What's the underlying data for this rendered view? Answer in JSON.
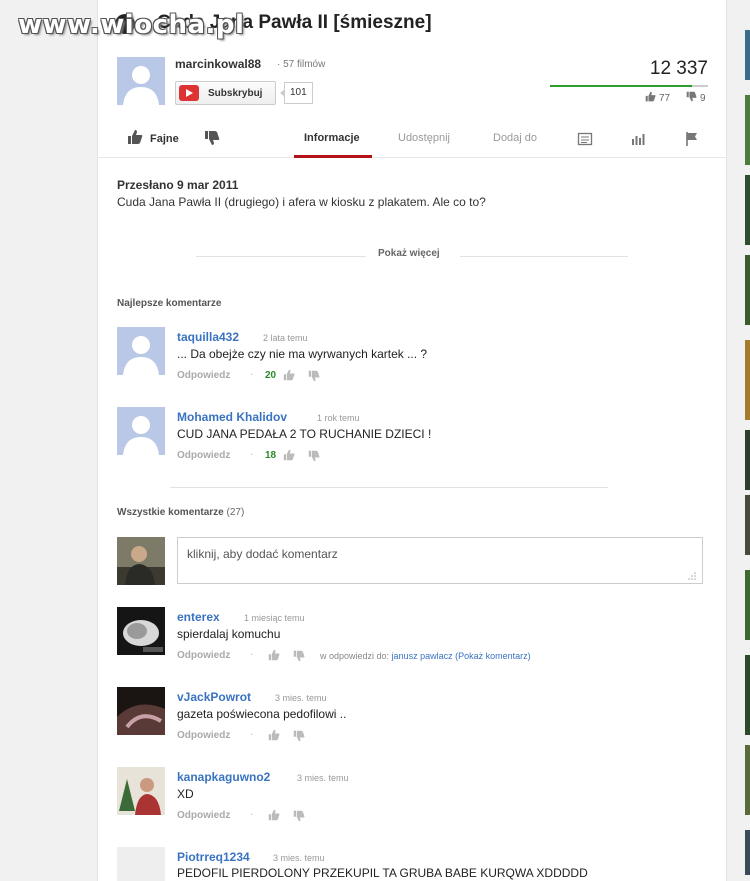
{
  "watermark": "www.wiocha.pl",
  "video": {
    "title": "Cuda Jana Pawła II [śmieszne]",
    "channel": "marcinkowal88",
    "video_count": "· 57 filmów",
    "subscribe_label": "Subskrybuj",
    "subscriber_count": "101",
    "views": "12 337",
    "likes": "77",
    "dislikes": "9",
    "like_ratio": 0.9
  },
  "actions": {
    "like_label": "Fajne",
    "tabs": [
      "Informacje",
      "Udostępnij",
      "Dodaj do"
    ],
    "active_tab": "Informacje"
  },
  "description": {
    "uploaded": "Przesłano 9 mar 2011",
    "text": "Cuda Jana Pawła II (drugiego) i afera w kiosku z plakatem. Ale co to?",
    "show_more": "Pokaż więcej"
  },
  "best_comments": {
    "heading": "Najlepsze komentarze",
    "items": [
      {
        "author": "taquilla432",
        "time": "2 lata temu",
        "text": "... Da obejże czy nie ma wyrwanych kartek ... ?",
        "reply": "Odpowiedz",
        "score": "20"
      },
      {
        "author": "Mohamed Khalidov",
        "time": "1 rok temu",
        "text": "CUD JANA PEDAŁA 2 TO RUCHANIE DZIECI !",
        "reply": "Odpowiedz",
        "score": "18"
      }
    ]
  },
  "all_comments": {
    "heading": "Wszystkie komentarze",
    "count": "(27)",
    "input_placeholder": "kliknij, aby dodać komentarz",
    "items": [
      {
        "author": "enterex",
        "time": "1 miesiąc temu",
        "text": "spierdalaj komuchu",
        "reply": "Odpowiedz",
        "ref_prefix": "w odpowiedzi do:",
        "ref_user": "janusz pawlacz",
        "ref_link": "(Pokaż komentarz)"
      },
      {
        "author": "vJackPowrot",
        "time": "3 mies. temu",
        "text": "gazeta poświecona pedofilowi ..",
        "reply": "Odpowiedz"
      },
      {
        "author": "kanapkaguwno2",
        "time": "3 mies. temu",
        "text": "XD",
        "reply": "Odpowiedz"
      },
      {
        "author": "Piotrreq1234",
        "time": "3 mies. temu",
        "text": "PEDOFIL PIERDOLONY PRZEKUPIL TA GRUBA BABE KURQWA XDDDDD"
      }
    ]
  },
  "colors": {
    "link_blue": "#3a73c0",
    "score_green": "#2a8a2a",
    "active_tab_red": "#b31217",
    "subscribe_red": "#dd3333"
  }
}
